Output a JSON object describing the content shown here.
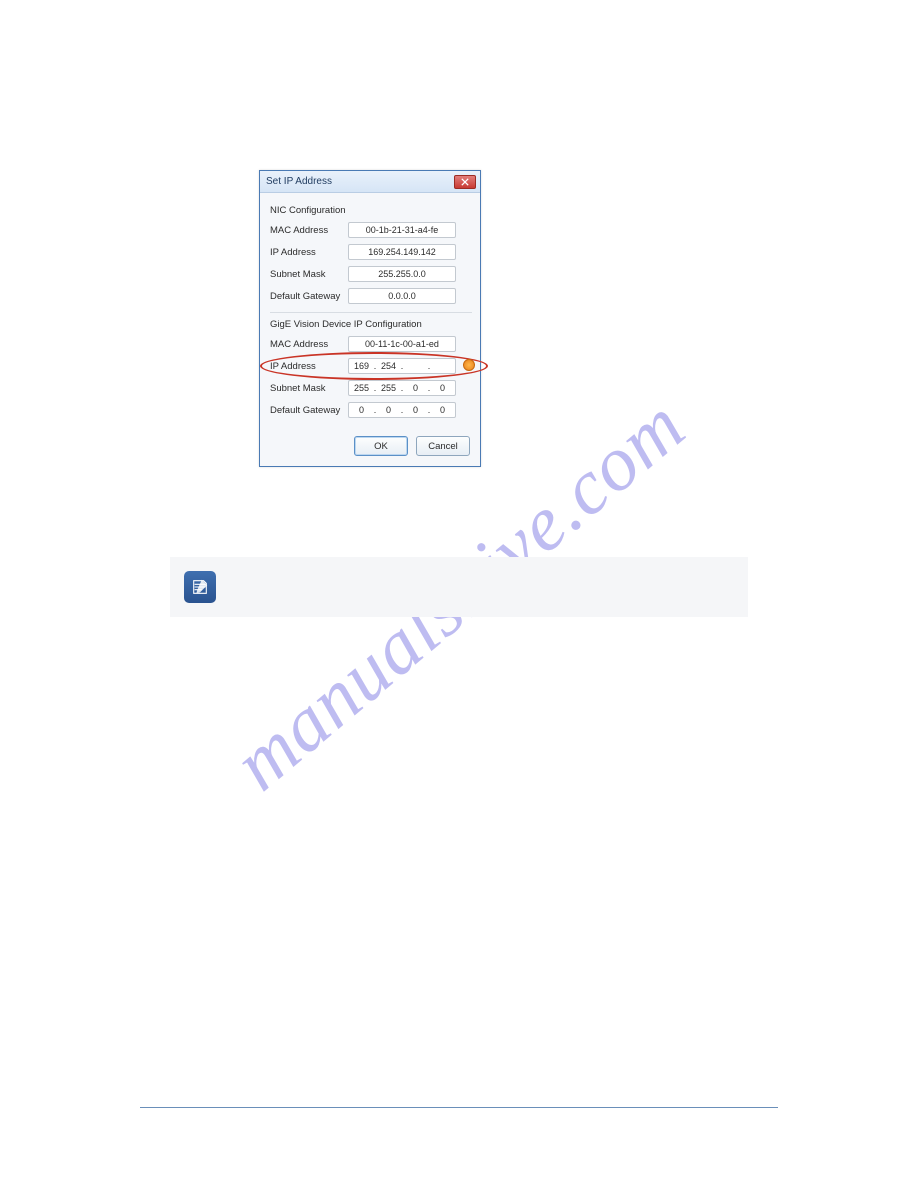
{
  "watermark": "manualshive.com",
  "dialog": {
    "title": "Set IP Address",
    "nic": {
      "section": "NIC Configuration",
      "mac_label": "MAC Address",
      "mac_value": "00-1b-21-31-a4-fe",
      "ip_label": "IP Address",
      "ip_value": "169.254.149.142",
      "subnet_label": "Subnet Mask",
      "subnet_value": "255.255.0.0",
      "gateway_label": "Default Gateway",
      "gateway_value": "0.0.0.0"
    },
    "device": {
      "section": "GigE Vision Device IP Configuration",
      "mac_label": "MAC Address",
      "mac_value": "00-11-1c-00-a1-ed",
      "ip_label": "IP Address",
      "ip_oct1": "169",
      "ip_oct2": "254",
      "ip_oct3": "",
      "ip_oct4": "",
      "subnet_label": "Subnet Mask",
      "sub_oct1": "255",
      "sub_oct2": "255",
      "sub_oct3": "0",
      "sub_oct4": "0",
      "gateway_label": "Default Gateway",
      "gw_oct1": "0",
      "gw_oct2": "0",
      "gw_oct3": "0",
      "gw_oct4": "0"
    },
    "ok": "OK",
    "cancel": "Cancel"
  },
  "page_number": ""
}
